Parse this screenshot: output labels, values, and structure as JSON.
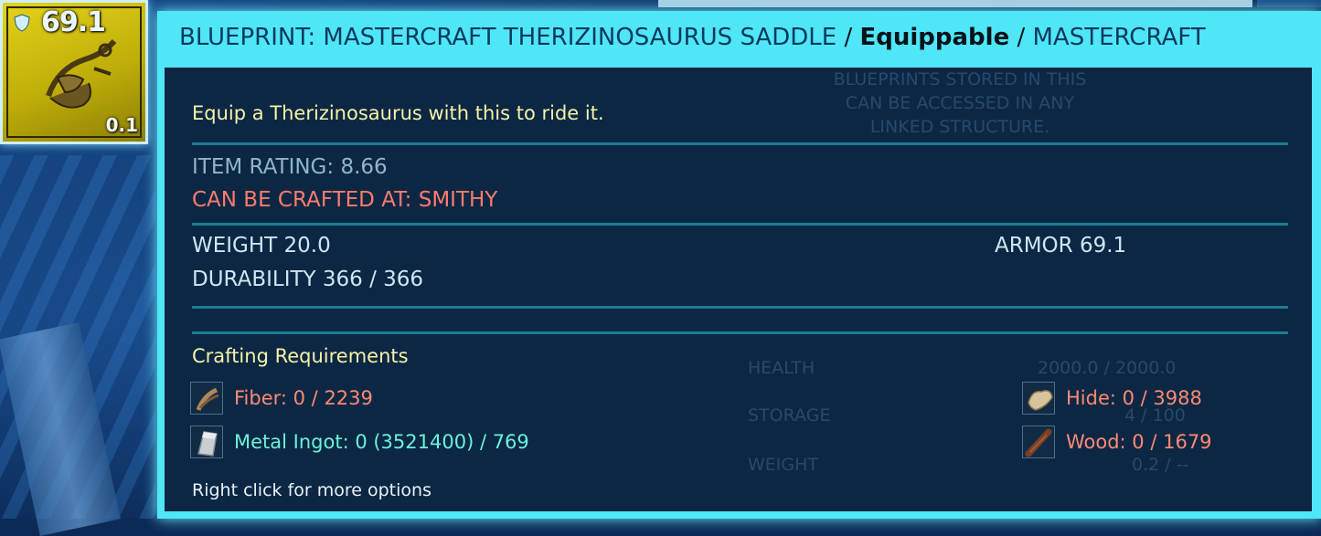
{
  "item_slot": {
    "armor_value": "69.1",
    "weight_value": "0.1",
    "icon": "saddle-icon",
    "badge_icon": "shield-icon",
    "background_color": "#d4c313"
  },
  "tooltip": {
    "title_main": "BLUEPRINT: MASTERCRAFT THERIZINOSAURUS SADDLE",
    "title_sep1": " / ",
    "title_type": "Equippable",
    "title_sep2": " / ",
    "title_quality": "MASTERCRAFT",
    "description": "Equip a Therizinosaurus with this to ride it.",
    "item_rating": "ITEM RATING: 8.66",
    "crafted_at": "CAN BE CRAFTED AT: SMITHY",
    "weight": "WEIGHT 20.0",
    "armor": "ARMOR 69.1",
    "durability": "DURABILITY 366 / 366",
    "crafting_header": "Crafting Requirements",
    "resources": [
      {
        "label": "Fiber: 0 / 2239",
        "icon": "fiber-icon",
        "color": "#ff8a73"
      },
      {
        "label": "Hide: 0 / 3988",
        "icon": "hide-icon",
        "color": "#ff8a73"
      },
      {
        "label": "Metal Ingot: 0 (3521400) / 769",
        "icon": "metal-ingot-icon",
        "color": "#6df2d8"
      },
      {
        "label": "Wood: 0 / 1679",
        "icon": "wood-icon",
        "color": "#ff8a73"
      }
    ],
    "hint": "Right click for more options",
    "accent_color": "#4fe6f7"
  },
  "background_panel": {
    "note_line1": "BLUEPRINTS STORED IN THIS",
    "note_line2": "CAN BE ACCESSED IN ANY",
    "note_line3": "LINKED STRUCTURE.",
    "health_label": "HEALTH",
    "health_value": "2000.0 / 2000.0",
    "storage_label": "STORAGE",
    "storage_value": "4 / 100",
    "weight_label": "WEIGHT",
    "weight_value": "0.2 / --"
  }
}
